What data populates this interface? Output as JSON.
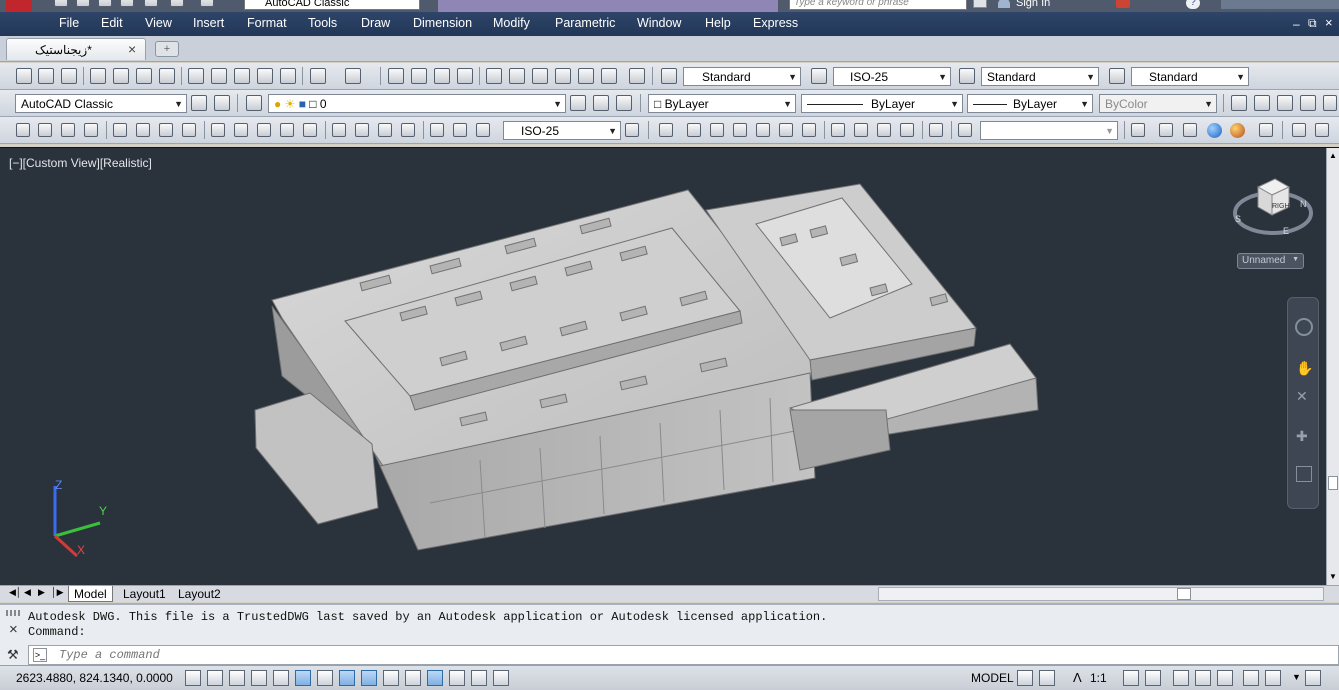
{
  "titlebar": {
    "workspace": "AutoCAD Classic",
    "search_placeholder": "Type a keyword or phrase",
    "signin": "Sign In",
    "help": "?"
  },
  "menu": [
    "File",
    "Edit",
    "View",
    "Insert",
    "Format",
    "Tools",
    "Draw",
    "Dimension",
    "Modify",
    "Parametric",
    "Window",
    "Help",
    "Express"
  ],
  "document_tab": {
    "title": "*زیجناستیک",
    "close": "×"
  },
  "toolbar1": {
    "text_style": "Standard",
    "dim_style": "ISO-25",
    "table_style": "Standard",
    "mleader_style": "Standard"
  },
  "toolbar2": {
    "workspace": "AutoCAD Classic",
    "layer": "0",
    "color": "ByLayer",
    "linetype": "ByLayer",
    "lineweight": "ByLayer",
    "plot_style": "ByColor"
  },
  "toolbar3": {
    "dim_style": "ISO-25",
    "visual_style": ""
  },
  "viewport": {
    "label": "[−][Custom View][Realistic]",
    "viewcube_face": "RIGHT",
    "compass_s": "S",
    "compass_n": "N",
    "compass_e": "E",
    "ucs_label": "Unnamed",
    "axis_x": "X",
    "axis_y": "Y",
    "axis_z": "Z"
  },
  "layout_tabs": [
    "Model",
    "Layout1",
    "Layout2"
  ],
  "command": {
    "lines": [
      "Autodesk DWG.  This file is a TrustedDWG last saved by an Autodesk application or Autodesk licensed application.",
      "Command:"
    ],
    "placeholder": "Type a command",
    "close": "×"
  },
  "status": {
    "coords": "2623.4880, 824.1340, 0.0000",
    "space": "MODEL",
    "scale": "1:1"
  },
  "colors": {
    "viewport_bg": "#2a323c",
    "menubar": "#2e4569",
    "building": "#c9c9c9"
  }
}
